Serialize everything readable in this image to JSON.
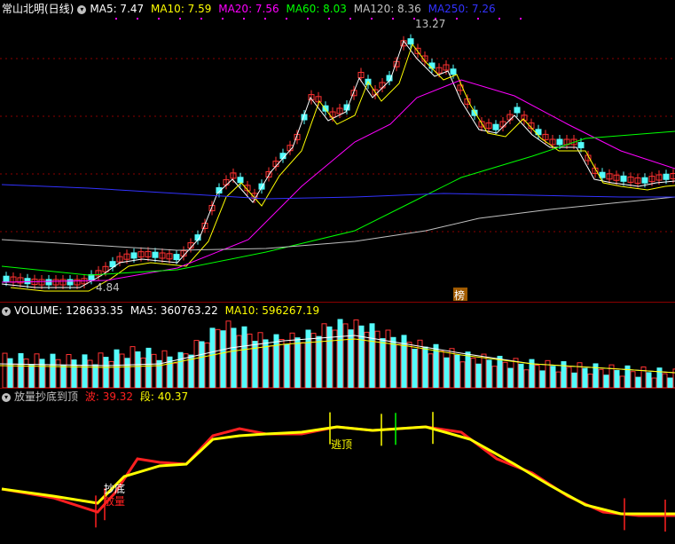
{
  "price_header": {
    "title": "常山北明(日线)",
    "ma5": "MA5: 7.47",
    "ma10": "MA10: 7.59",
    "ma20": "MA20: 7.56",
    "ma60": "MA60: 8.03",
    "ma120": "MA120: 8.36",
    "ma250": "MA250: 7.26"
  },
  "price_annotations": {
    "high": "13.27",
    "low": "4.84",
    "badge": "榜"
  },
  "volume_header": {
    "volume": "VOLUME: 128633.35",
    "ma5": "MA5: 360763.22",
    "ma10": "MA10: 596267.19"
  },
  "indicator_header": {
    "name": "放量抄底到顶",
    "wave": "波: 39.32",
    "segment": "段: 40.37"
  },
  "indicator_annotations": {
    "bottom": "抄底",
    "volume": "放量",
    "top": "逃顶"
  },
  "colors": {
    "background": "#000000",
    "up": "#ff3232",
    "down": "#54fcfc",
    "ma5": "#ffffff",
    "ma10": "#ffff00",
    "ma20": "#ff00ff",
    "ma60": "#00ff00",
    "ma120": "#c0c0c0",
    "ma250": "#3232ff",
    "wave": "#ff2020",
    "segment": "#ffff00"
  },
  "icons": {
    "header_toggle": "circle-chevron-icon"
  }
}
